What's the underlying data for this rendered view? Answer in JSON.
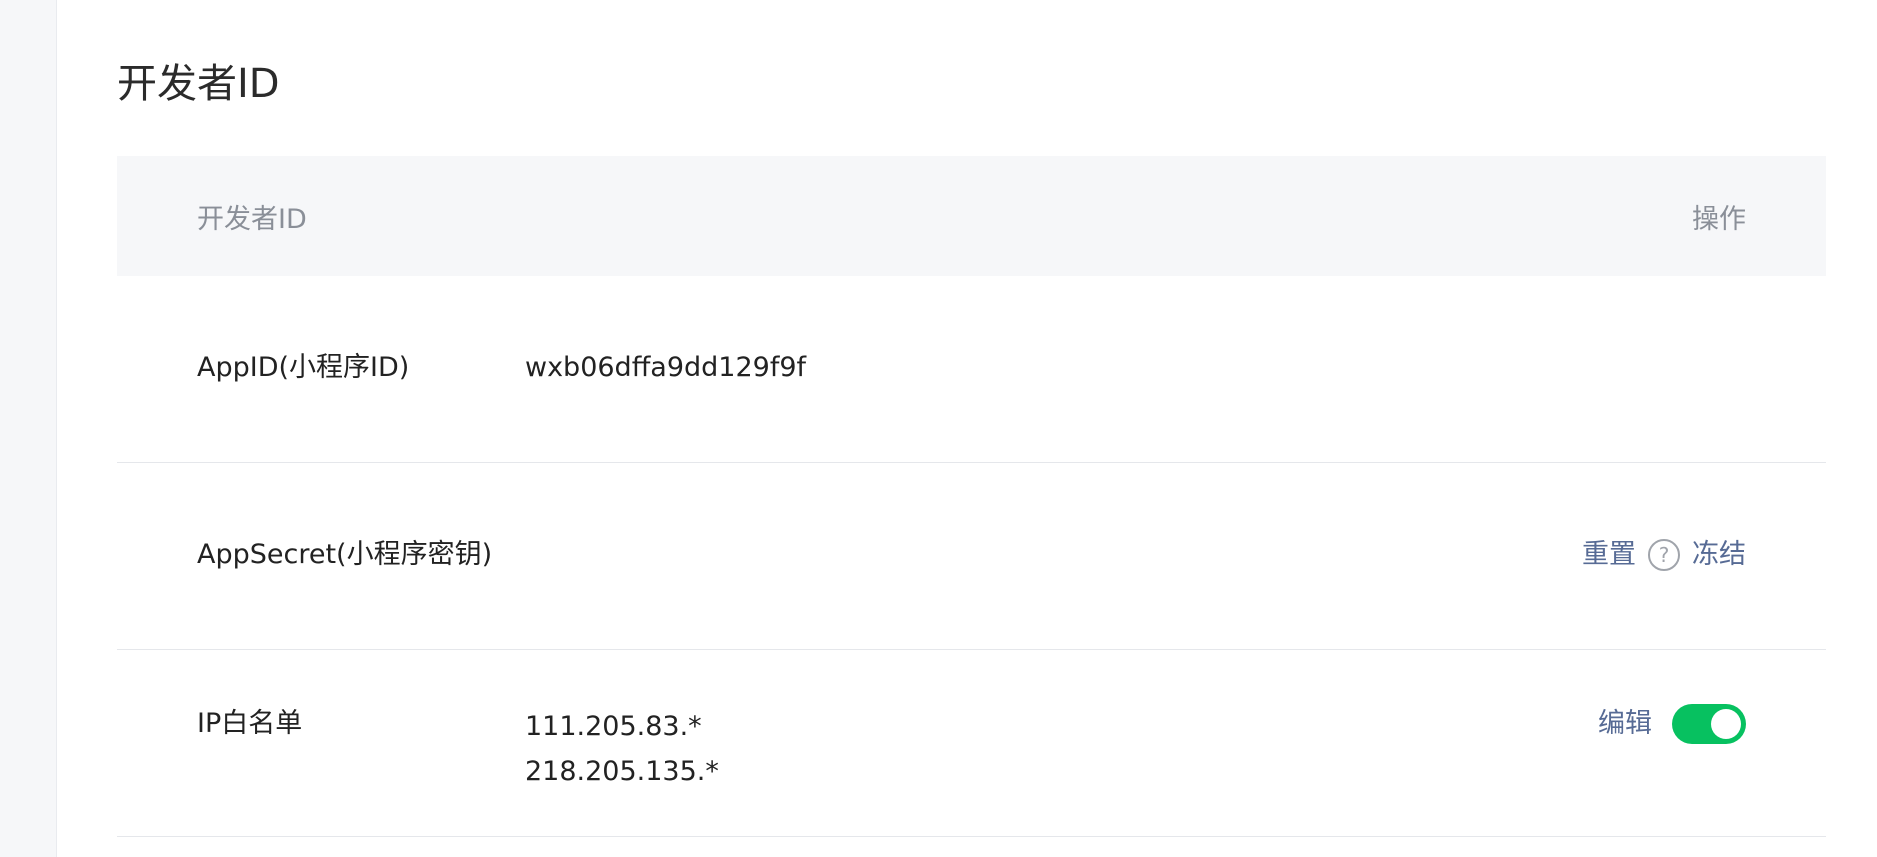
{
  "page": {
    "title": "开发者ID"
  },
  "table": {
    "header": {
      "name": "开发者ID",
      "action": "操作"
    },
    "rows": [
      {
        "label": "AppID(小程序ID)",
        "value": "wxb06dffa9dd129f9f"
      },
      {
        "label": "AppSecret(小程序密钥)",
        "actions": {
          "reset": "重置",
          "help_icon": "question-circle-icon",
          "help_glyph": "?",
          "freeze": "冻结"
        }
      },
      {
        "label": "IP白名单",
        "values": [
          "111.205.83.*",
          "218.205.135.*"
        ],
        "actions": {
          "edit": "编辑",
          "toggle_on": true
        }
      }
    ]
  },
  "colors": {
    "link": "#576b95",
    "toggle_on": "#07c160",
    "header_bg": "#f6f7f9"
  }
}
